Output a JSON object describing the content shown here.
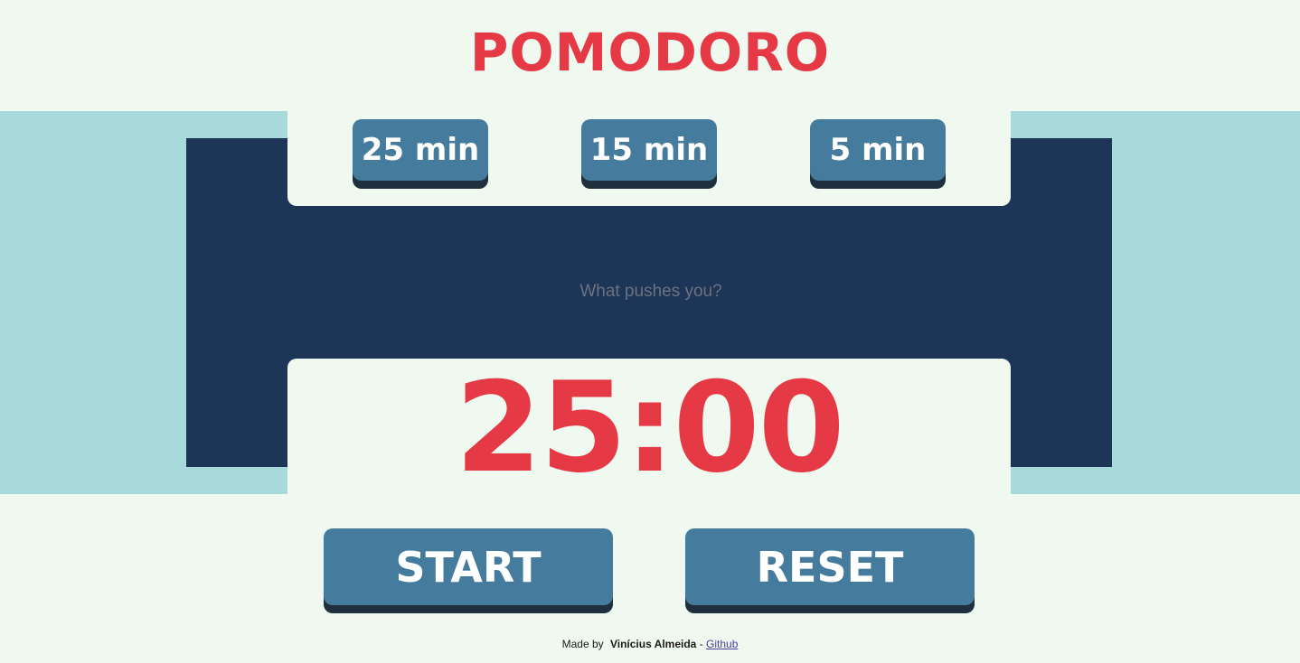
{
  "header": {
    "title": "POMODORO"
  },
  "presets": [
    {
      "label": "25 min"
    },
    {
      "label": "15 min"
    },
    {
      "label": "5 min"
    }
  ],
  "motivation": {
    "placeholder": "What pushes you?",
    "value": ""
  },
  "timer": {
    "display": "25:00"
  },
  "controls": {
    "start_label": "START",
    "reset_label": "RESET"
  },
  "footer": {
    "made_by": "Made by",
    "author": "Vinícius Almeida",
    "separator": "-",
    "link_label": "Github"
  },
  "colors": {
    "background": "#f0f9ef",
    "band": "#a8dadc",
    "navy": "#1d3557",
    "accent_red": "#e63946",
    "button_blue": "#457b9d",
    "button_shadow": "#1f2f3d"
  }
}
